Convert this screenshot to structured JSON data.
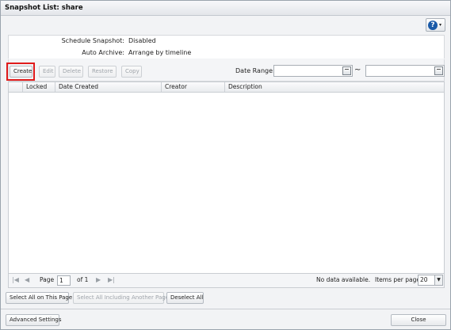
{
  "window": {
    "title": "Snapshot List: share"
  },
  "help": {
    "icon": "help-icon",
    "symbol": "?",
    "caret": "▾"
  },
  "info": {
    "schedule_label": "Schedule Snapshot:",
    "schedule_value": "Disabled",
    "archive_label": "Auto Archive:",
    "archive_value": "Arrange by timeline"
  },
  "toolbar": {
    "create": "Create",
    "edit": "Edit",
    "delete": "Delete",
    "restore": "Restore",
    "copy": "Copy",
    "date_range_label": "Date Range:",
    "date_from": "",
    "date_to": "",
    "range_separator": "~"
  },
  "table": {
    "columns": [
      "",
      "Locked",
      "Date Created",
      "Creator",
      "Description"
    ],
    "rows": []
  },
  "pager": {
    "page_label": "Page",
    "page_value": "1",
    "of_label": "of 1",
    "status": "No data available.",
    "items_per_page_label": "Items per page:",
    "items_per_page_value": "20",
    "first": "|◀",
    "prev": "◀",
    "next": "▶",
    "last": "▶|"
  },
  "selection": {
    "select_all_page": "Select All on This Page",
    "select_all_including": "Select All Including Another Page",
    "deselect_all": "Deselect All"
  },
  "footer": {
    "advanced": "Advanced Settings",
    "close": "Close"
  },
  "colors": {
    "highlight": "#e01b1b",
    "help_blue": "#1a5aa8"
  }
}
